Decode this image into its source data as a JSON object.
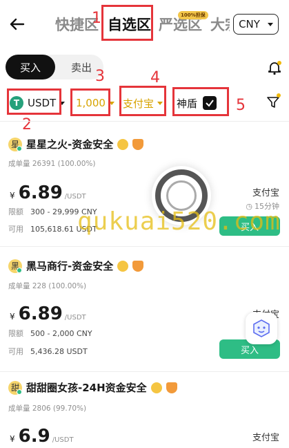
{
  "header": {
    "tabs": [
      {
        "label": "快捷区"
      },
      {
        "label": "自选区",
        "active": true
      },
      {
        "label": "严选区"
      },
      {
        "label": "大宗"
      }
    ],
    "promo_badge": "100%担保",
    "currency": "CNY"
  },
  "trade_toggle": {
    "buy_label": "买入",
    "sell_label": "卖出",
    "selected": "买入"
  },
  "filters": {
    "coin": "USDT",
    "amount": "1,000",
    "payment": "支付宝",
    "shield_label": "神盾",
    "shield_checked": true
  },
  "annotations": [
    "1",
    "2",
    "3",
    "4",
    "5"
  ],
  "watermark": "qukuai520.com",
  "listings": [
    {
      "avatar_char": "星",
      "merchant": "星星之火-资金安全",
      "orders_label": "成单量",
      "orders": "26391 (100.00%)",
      "currency_symbol": "¥",
      "price": "6.89",
      "unit": "/USDT",
      "limit_label": "限额",
      "limit": "300 - 29,999 CNY",
      "available_label": "可用",
      "available": "105,618.61 USDT",
      "payment": "支付宝",
      "time": "15分钟",
      "action": "买入"
    },
    {
      "avatar_char": "黑",
      "merchant": "黑马商行-资金安全",
      "orders_label": "成单量",
      "orders": "228 (100.00%)",
      "currency_symbol": "¥",
      "price": "6.89",
      "unit": "/USDT",
      "limit_label": "限额",
      "limit": "500 - 2,000 CNY",
      "available_label": "可用",
      "available": "5,436.28 USDT",
      "payment": "支付宝",
      "time": "",
      "action": "买入"
    },
    {
      "avatar_char": "甜",
      "merchant": "甜甜圈女孩-24H资金安全",
      "orders_label": "成单量",
      "orders": "2806 (99.70%)",
      "currency_symbol": "¥",
      "price": "6.9",
      "unit": "/USDT",
      "payment": "支付宝"
    }
  ],
  "colors": {
    "buy_green": "#2ebd85",
    "annotation_red": "#e5343a",
    "gold": "#d7a300"
  }
}
